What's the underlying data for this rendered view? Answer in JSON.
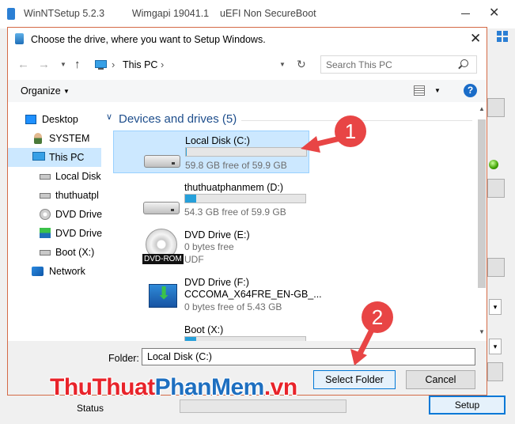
{
  "background_app": {
    "title": "WinNTSetup 5.2.3          Wimgapi 19041.1    uEFI Non SecureBoot",
    "status_label": "Status",
    "setup_button": "Setup"
  },
  "dialog": {
    "title": "Choose the drive, where you want to Setup Windows.",
    "address": {
      "location": "This PC"
    },
    "search": {
      "placeholder": "Search This PC"
    },
    "toolbar": {
      "organize": "Organize"
    },
    "nav": [
      {
        "label": "Desktop",
        "icon": "desktop-icon"
      },
      {
        "label": "SYSTEM",
        "icon": "user-icon"
      },
      {
        "label": "This PC",
        "icon": "computer-icon",
        "selected": true
      },
      {
        "label": "Local Disk",
        "icon": "drive-icon"
      },
      {
        "label": "thuthuatpl",
        "icon": "drive-icon"
      },
      {
        "label": "DVD Drive",
        "icon": "disc-icon"
      },
      {
        "label": "DVD Drive",
        "icon": "setup-disc-icon"
      },
      {
        "label": "Boot (X:)",
        "icon": "drive-icon"
      },
      {
        "label": "Network",
        "icon": "network-icon"
      }
    ],
    "group": {
      "title": "Devices and drives (5)"
    },
    "drives": [
      {
        "name": "Local Disk (C:)",
        "free": "59.8 GB free of 59.9 GB",
        "used_fraction": 0.002,
        "selected": true,
        "icon": "hard-drive-icon"
      },
      {
        "name": "thuthuatphanmem (D:)",
        "free": "54.3 GB free of 59.9 GB",
        "used_fraction": 0.09,
        "icon": "hard-drive-icon"
      },
      {
        "name": "DVD Drive (E:)",
        "free": "0 bytes free",
        "fs": "UDF",
        "icon": "dvd-rom-icon",
        "badge": "DVD-ROM"
      },
      {
        "name": "DVD Drive (F:)",
        "label": "CCCOMA_X64FRE_EN-GB_...",
        "free": "0 bytes free of 5.43 GB",
        "icon": "setup-disc-icon"
      },
      {
        "name": "Boot (X:)",
        "used_fraction": 0.09,
        "icon": "hard-drive-icon"
      }
    ],
    "folder": {
      "label": "Folder:",
      "value": "Local Disk (C:)"
    },
    "buttons": {
      "select": "Select Folder",
      "cancel": "Cancel"
    }
  },
  "annotations": {
    "marker1": "1",
    "marker2": "2",
    "accent": "#e84545"
  },
  "watermark": {
    "part1": "ThuThuat",
    "part2": "PhanMem",
    "part3": ".vn"
  },
  "colors": {
    "selection": "#cce8ff",
    "accent_blue": "#0078d7",
    "title_blue": "#1e4e8c",
    "progress": "#26a0da"
  }
}
